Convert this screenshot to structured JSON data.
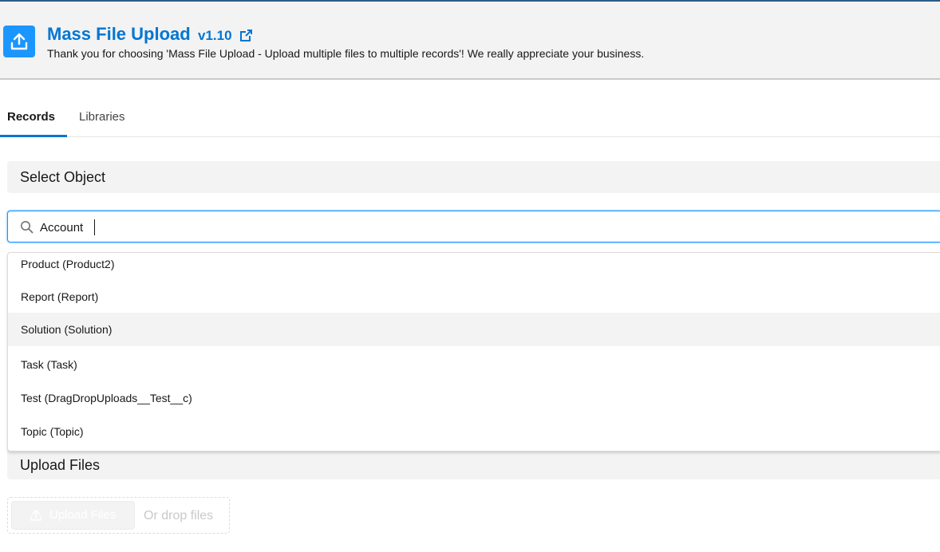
{
  "header": {
    "title": "Mass File Upload",
    "version": "v1.10",
    "subtitle": "Thank you for choosing 'Mass File Upload - Upload multiple files to multiple records'! We really appreciate your business.",
    "app_icon": "upload-icon",
    "link_icon": "external-link-icon",
    "accent_color": "#0176d3"
  },
  "tabs": [
    {
      "label": "Records",
      "active": true
    },
    {
      "label": "Libraries",
      "active": false
    }
  ],
  "select_object": {
    "section_label": "Select Object",
    "search_value": "Account",
    "search_icon": "search-icon",
    "options": [
      {
        "label": "Product (Product2)",
        "highlighted": false
      },
      {
        "label": "Report (Report)",
        "highlighted": false
      },
      {
        "label": "Solution (Solution)",
        "highlighted": true
      },
      {
        "label": "Task (Task)",
        "highlighted": false
      },
      {
        "label": "Test (DragDropUploads__Test__c)",
        "highlighted": false
      },
      {
        "label": "Topic (Topic)",
        "highlighted": false
      }
    ]
  },
  "upload": {
    "section_label": "Upload Files",
    "button_label": "Upload Files",
    "drop_text": "Or drop files",
    "button_icon": "upload-icon"
  }
}
